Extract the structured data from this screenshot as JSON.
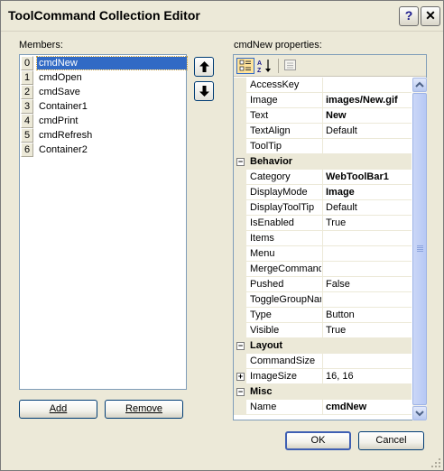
{
  "window": {
    "title": "ToolCommand Collection Editor",
    "help_glyph": "?",
    "close_glyph": "✕"
  },
  "members": {
    "label": "Members:",
    "items": [
      {
        "index": "0",
        "name": "cmdNew",
        "selected": true
      },
      {
        "index": "1",
        "name": "cmdOpen"
      },
      {
        "index": "2",
        "name": "cmdSave"
      },
      {
        "index": "3",
        "name": "Container1"
      },
      {
        "index": "4",
        "name": "cmdPrint"
      },
      {
        "index": "5",
        "name": "cmdRefresh"
      },
      {
        "index": "6",
        "name": "Container2"
      }
    ],
    "add_label": "Add",
    "remove_label": "Remove"
  },
  "properties": {
    "label": "cmdNew properties:",
    "toolbar": {
      "categorized_icon": "categorized-icon",
      "alphabetical_icon": "alphabetical-icon",
      "property-pages_icon": "property-pages-icon"
    },
    "rows": [
      {
        "type": "prop",
        "name": "AccessKey",
        "value": ""
      },
      {
        "type": "prop",
        "name": "Image",
        "value": "images/New.gif",
        "bold": true
      },
      {
        "type": "prop",
        "name": "Text",
        "value": "New",
        "bold": true
      },
      {
        "type": "prop",
        "name": "TextAlign",
        "value": "Default"
      },
      {
        "type": "prop",
        "name": "ToolTip",
        "value": ""
      },
      {
        "type": "cat",
        "name": "Behavior",
        "expander": "−"
      },
      {
        "type": "prop",
        "name": "Category",
        "value": "WebToolBar1",
        "bold": true
      },
      {
        "type": "prop",
        "name": "DisplayMode",
        "value": "Image",
        "bold": true
      },
      {
        "type": "prop",
        "name": "DisplayToolTip",
        "value": "Default"
      },
      {
        "type": "prop",
        "name": "IsEnabled",
        "value": "True"
      },
      {
        "type": "prop",
        "name": "Items",
        "value": ""
      },
      {
        "type": "prop",
        "name": "Menu",
        "value": ""
      },
      {
        "type": "prop",
        "name": "MergeCommandS",
        "value": ""
      },
      {
        "type": "prop",
        "name": "Pushed",
        "value": "False"
      },
      {
        "type": "prop",
        "name": "ToggleGroupNan",
        "value": ""
      },
      {
        "type": "prop",
        "name": "Type",
        "value": "Button"
      },
      {
        "type": "prop",
        "name": "Visible",
        "value": "True"
      },
      {
        "type": "cat",
        "name": "Layout",
        "expander": "−"
      },
      {
        "type": "prop",
        "name": "CommandSize",
        "value": ""
      },
      {
        "type": "prop",
        "name": "ImageSize",
        "value": "16, 16",
        "expander": "+"
      },
      {
        "type": "cat",
        "name": "Misc",
        "expander": "−"
      },
      {
        "type": "prop",
        "name": "Name",
        "value": "cmdNew",
        "bold": true
      }
    ]
  },
  "footer": {
    "ok_label": "OK",
    "cancel_label": "Cancel"
  },
  "colors": {
    "selection": "#316ac5",
    "dialog_bg": "#ece9d8",
    "border": "#7f9db9"
  }
}
